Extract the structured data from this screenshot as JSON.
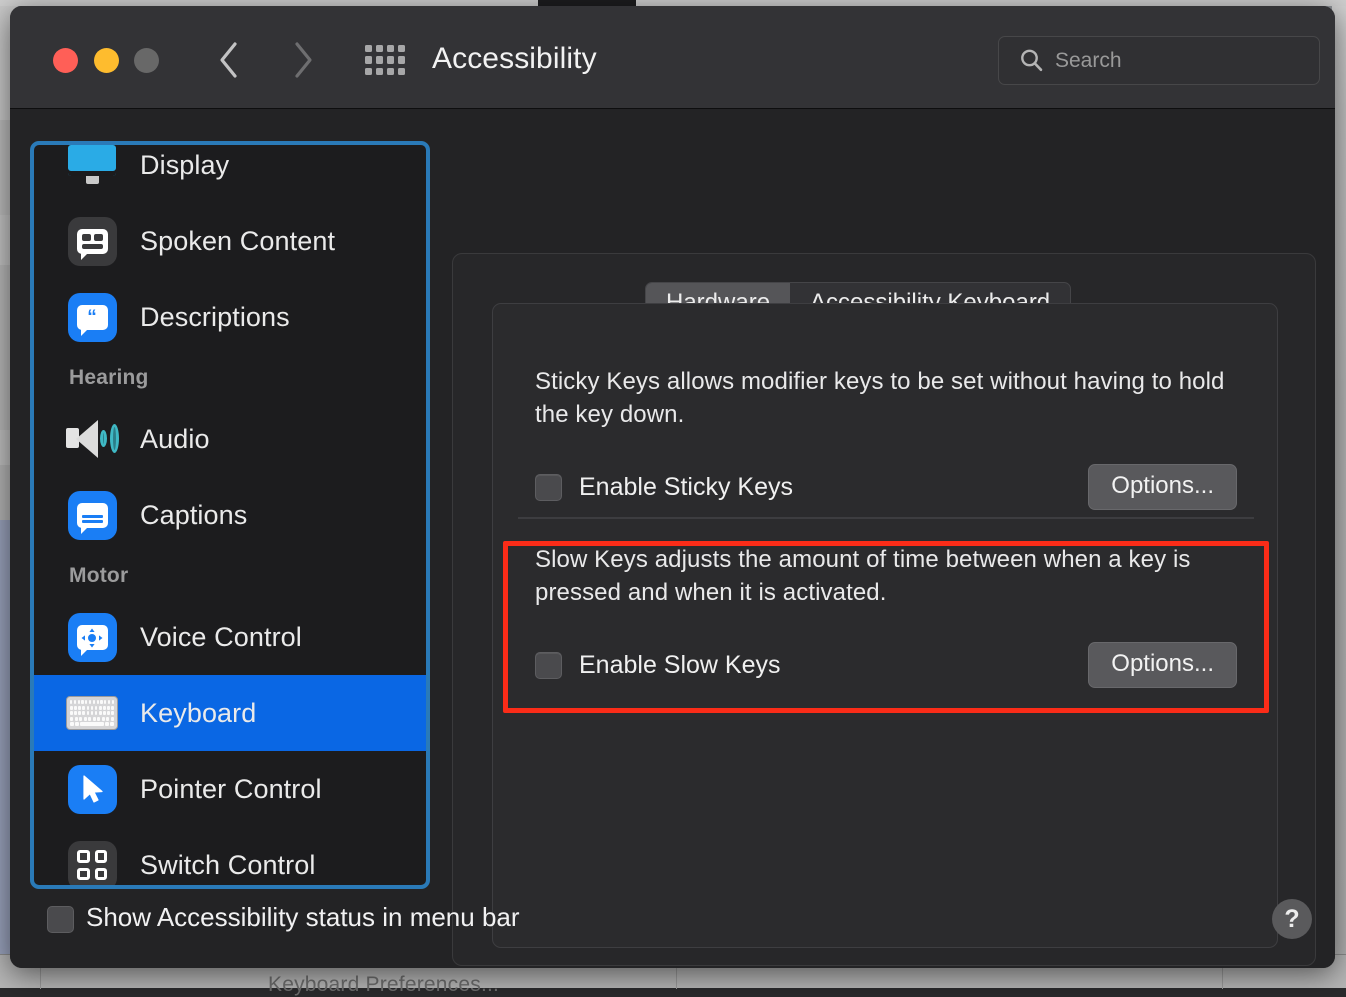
{
  "window": {
    "title": "Accessibility",
    "traffic_lights": [
      "close",
      "minimize",
      "zoom"
    ],
    "back_label": "Back",
    "forward_label": "Forward",
    "grid_label": "Show All"
  },
  "search": {
    "placeholder": "Search",
    "value": ""
  },
  "sidebar": {
    "items": [
      {
        "label": "Display",
        "icon": "display-icon",
        "group": null,
        "selected": false
      },
      {
        "label": "Spoken Content",
        "icon": "spoken-content-icon",
        "group": null,
        "selected": false
      },
      {
        "label": "Descriptions",
        "icon": "descriptions-icon",
        "group": null,
        "selected": false
      },
      {
        "label": "Audio",
        "icon": "audio-icon",
        "group": "Hearing",
        "selected": false
      },
      {
        "label": "Captions",
        "icon": "captions-icon",
        "group": null,
        "selected": false
      },
      {
        "label": "Voice Control",
        "icon": "voice-control-icon",
        "group": "Motor",
        "selected": false
      },
      {
        "label": "Keyboard",
        "icon": "keyboard-icon",
        "group": null,
        "selected": true
      },
      {
        "label": "Pointer Control",
        "icon": "pointer-control-icon",
        "group": null,
        "selected": false
      },
      {
        "label": "Switch Control",
        "icon": "switch-control-icon",
        "group": null,
        "selected": false
      }
    ],
    "groups": {
      "hearing": "Hearing",
      "motor": "Motor"
    },
    "selection_color": "#0a67e4",
    "focus_ring_color": "#2a7ab8"
  },
  "tabs": [
    {
      "label": "Hardware",
      "active": true
    },
    {
      "label": "Accessibility Keyboard",
      "active": false
    }
  ],
  "sticky_keys": {
    "description": "Sticky Keys allows modifier keys to be set without having to hold the key down.",
    "checkbox_label": "Enable Sticky Keys",
    "checked": false,
    "options_label": "Options..."
  },
  "slow_keys": {
    "description": "Slow Keys adjusts the amount of time between when a key is pressed and when it is activated.",
    "checkbox_label": "Enable Slow Keys",
    "checked": false,
    "options_label": "Options...",
    "highlight_color": "#fb2c18"
  },
  "bottom": {
    "checkbox_label": "Show Accessibility status in menu bar",
    "checked": false,
    "help_label": "?"
  },
  "background": {
    "obscured_text": "Keyboard Preferences..."
  }
}
